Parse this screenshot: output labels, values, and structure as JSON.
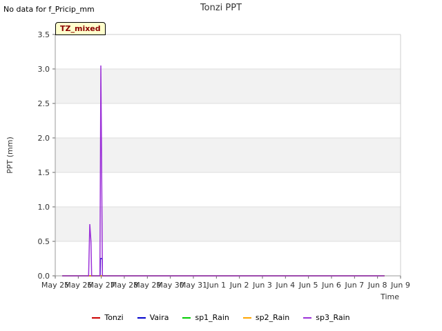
{
  "header": {
    "no_data": "No data for f_Pricip_mm",
    "badge": "TZ_mixed"
  },
  "chart_data": {
    "type": "line",
    "title": "Tonzi PPT",
    "xlabel": "Time",
    "ylabel": "PPT (mm)",
    "ylim": [
      0,
      3.5
    ],
    "xlim": [
      0,
      15
    ],
    "yticks": [
      0.0,
      0.5,
      1.0,
      1.5,
      2.0,
      2.5,
      3.0,
      3.5
    ],
    "ytick_labels": [
      "0.0",
      "0.5",
      "1.0",
      "1.5",
      "2.0",
      "2.5",
      "3.0",
      "3.5"
    ],
    "xticks": [
      0,
      1,
      2,
      3,
      4,
      5,
      6,
      7,
      8,
      9,
      10,
      11,
      12,
      13,
      14,
      15
    ],
    "xtick_labels": [
      "May 25",
      "May 26",
      "May 27",
      "May 28",
      "May 29",
      "May 30",
      "May 31",
      "Jun 1",
      "Jun 2",
      "Jun 3",
      "Jun 4",
      "Jun 5",
      "Jun 6",
      "Jun 7",
      "Jun 8",
      "Jun 9"
    ],
    "grid": true,
    "legend_position": "bottom",
    "series": [
      {
        "name": "Tonzi",
        "color": "#cc0000",
        "x": [
          0.3,
          14.3
        ],
        "y": [
          0,
          0
        ]
      },
      {
        "name": "Vaira",
        "color": "#0000cc",
        "x": [
          0.3,
          1.95,
          1.96,
          2.04,
          2.05,
          14.3
        ],
        "y": [
          0,
          0,
          0.25,
          0.25,
          0,
          0
        ]
      },
      {
        "name": "sp1_Rain",
        "color": "#00cc00",
        "x": [
          0.3,
          14.3
        ],
        "y": [
          0,
          0
        ]
      },
      {
        "name": "sp2_Rain",
        "color": "#ffa500",
        "x": [
          0.3,
          14.3
        ],
        "y": [
          0,
          0
        ]
      },
      {
        "name": "sp3_Rain",
        "color": "#9b30d8",
        "x": [
          0.3,
          1.45,
          1.5,
          1.55,
          1.58,
          1.94,
          1.98,
          2.0,
          2.05,
          14.3
        ],
        "y": [
          0,
          0,
          0.75,
          0.5,
          0,
          0,
          3.05,
          2.2,
          0,
          0
        ]
      }
    ]
  }
}
